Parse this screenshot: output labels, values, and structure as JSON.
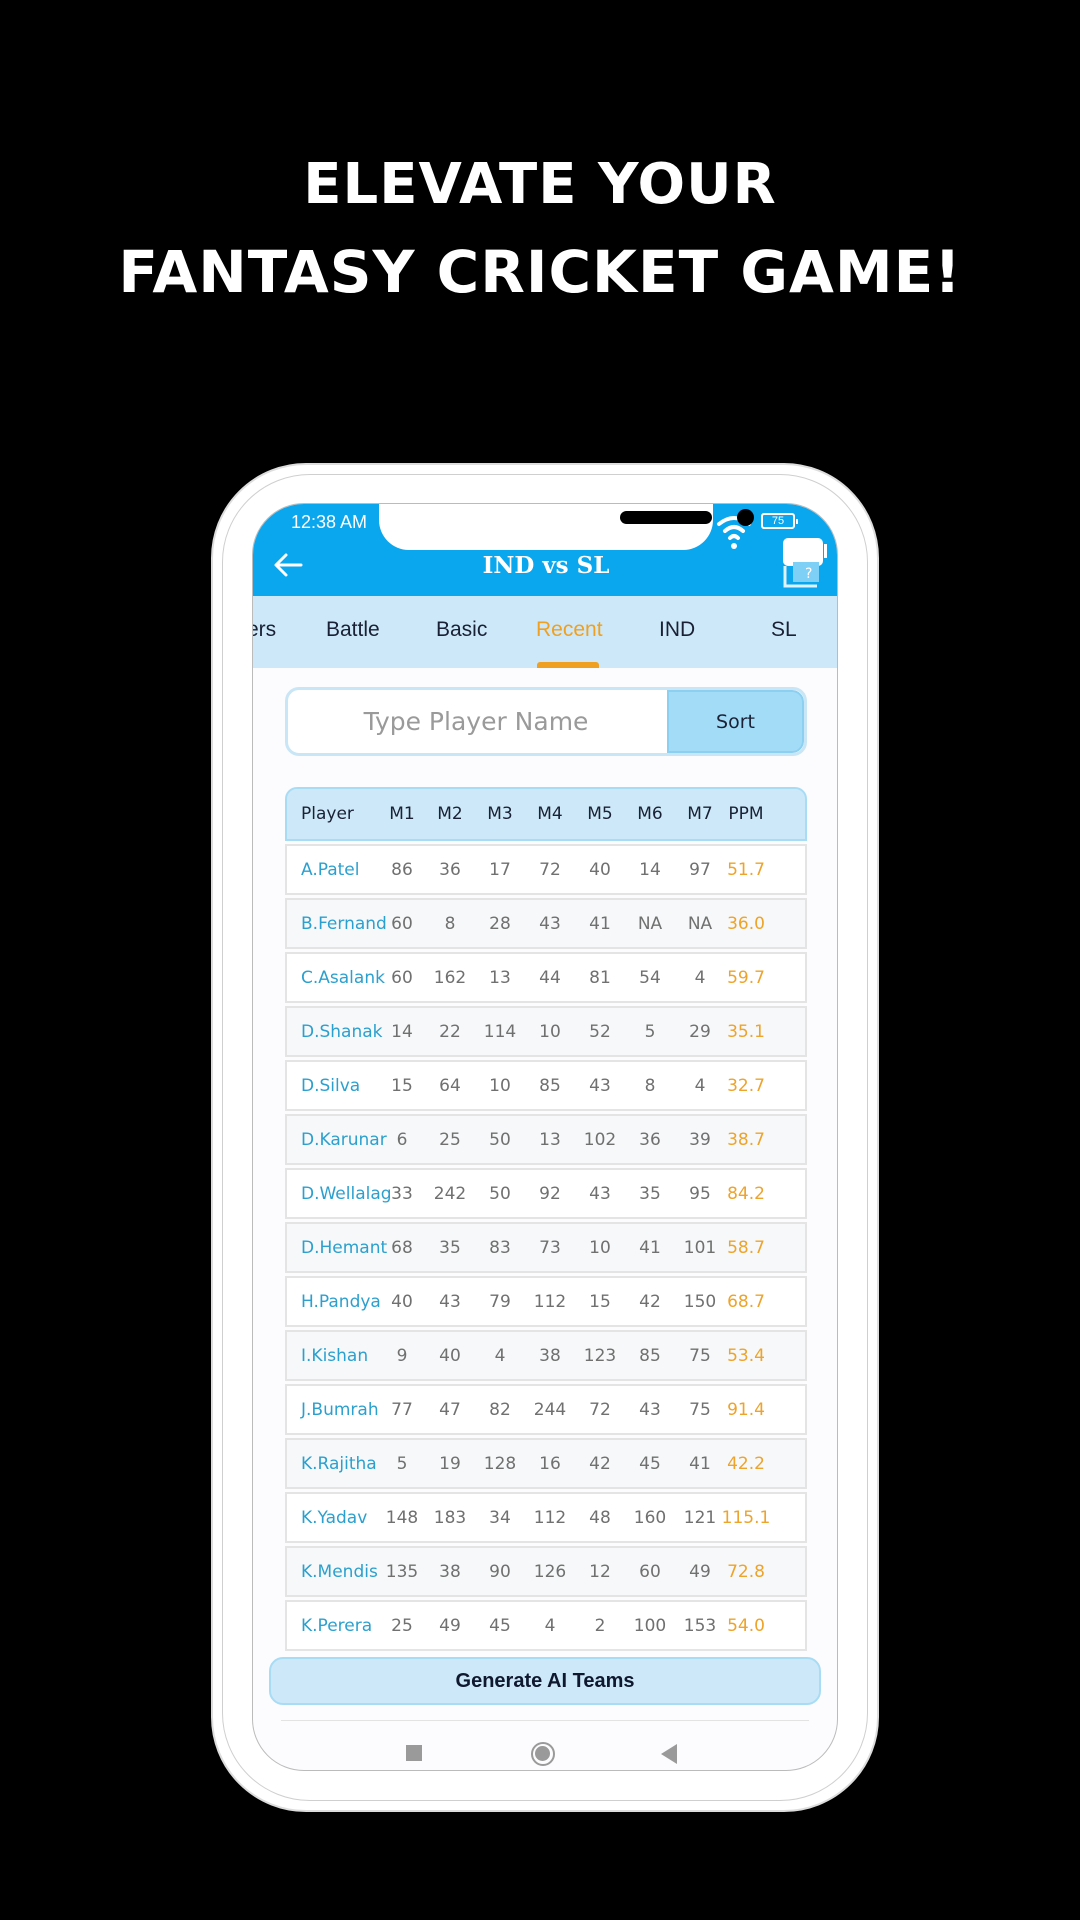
{
  "promo": {
    "line1": "ELEVATE YOUR",
    "line2": "FANTASY CRICKET GAME!"
  },
  "status_bar": {
    "time": "12:38 AM",
    "battery": "75"
  },
  "header": {
    "title": "IND vs SL",
    "back_icon": "arrow-left-icon",
    "help_icon": "help-icon"
  },
  "tabs": [
    {
      "label": "ers",
      "active": false
    },
    {
      "label": "Battle",
      "active": false
    },
    {
      "label": "Basic",
      "active": false
    },
    {
      "label": "Recent",
      "active": true
    },
    {
      "label": "IND",
      "active": false
    },
    {
      "label": "SL",
      "active": false
    }
  ],
  "search": {
    "placeholder": "Type Player Name",
    "value": "",
    "sort_label": "Sort"
  },
  "table": {
    "columns": [
      "Player",
      "M1",
      "M2",
      "M3",
      "M4",
      "M5",
      "M6",
      "M7",
      "PPM"
    ],
    "rows": [
      [
        "A.Patel",
        "86",
        "36",
        "17",
        "72",
        "40",
        "14",
        "97",
        "51.7"
      ],
      [
        "B.Fernand",
        "60",
        "8",
        "28",
        "43",
        "41",
        "NA",
        "NA",
        "36.0"
      ],
      [
        "C.Asalank",
        "60",
        "162",
        "13",
        "44",
        "81",
        "54",
        "4",
        "59.7"
      ],
      [
        "D.Shanak",
        "14",
        "22",
        "114",
        "10",
        "52",
        "5",
        "29",
        "35.1"
      ],
      [
        "D.Silva",
        "15",
        "64",
        "10",
        "85",
        "43",
        "8",
        "4",
        "32.7"
      ],
      [
        "D.Karunar",
        "6",
        "25",
        "50",
        "13",
        "102",
        "36",
        "39",
        "38.7"
      ],
      [
        "D.Wellalag",
        "33",
        "242",
        "50",
        "92",
        "43",
        "35",
        "95",
        "84.2"
      ],
      [
        "D.Hemant",
        "68",
        "35",
        "83",
        "73",
        "10",
        "41",
        "101",
        "58.7"
      ],
      [
        "H.Pandya",
        "40",
        "43",
        "79",
        "112",
        "15",
        "42",
        "150",
        "68.7"
      ],
      [
        "I.Kishan",
        "9",
        "40",
        "4",
        "38",
        "123",
        "85",
        "75",
        "53.4"
      ],
      [
        "J.Bumrah",
        "77",
        "47",
        "82",
        "244",
        "72",
        "43",
        "75",
        "91.4"
      ],
      [
        "K.Rajitha",
        "5",
        "19",
        "128",
        "16",
        "42",
        "45",
        "41",
        "42.2"
      ],
      [
        "K.Yadav",
        "148",
        "183",
        "34",
        "112",
        "48",
        "160",
        "121",
        "115.1"
      ],
      [
        "K.Mendis",
        "135",
        "38",
        "90",
        "126",
        "12",
        "60",
        "49",
        "72.8"
      ],
      [
        "K.Perera",
        "25",
        "49",
        "45",
        "4",
        "2",
        "100",
        "153",
        "54.0"
      ]
    ]
  },
  "actions": {
    "generate_label": "Generate AI Teams"
  },
  "colors": {
    "appbar": "#0aa6ee",
    "tab_bg": "#cde9f9",
    "accent": "#f0a020",
    "player_name": "#2ba0cf",
    "ppm": "#eea32a"
  }
}
